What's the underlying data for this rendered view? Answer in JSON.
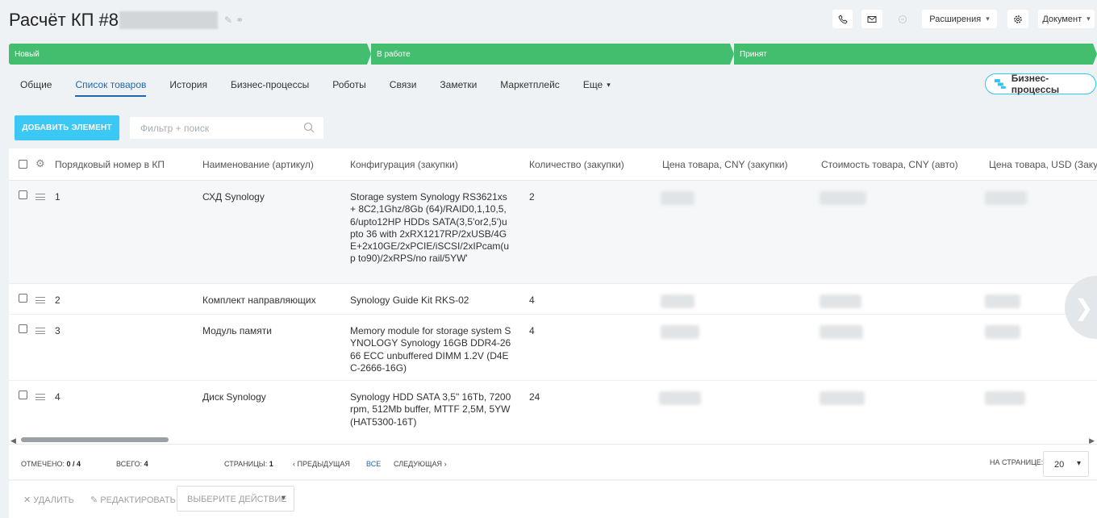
{
  "header": {
    "title": "Расчёт КП #8",
    "buttons": {
      "extensions": "Расширения",
      "document": "Документ"
    }
  },
  "stages": [
    "Новый",
    "В работе",
    "Принят"
  ],
  "tabs": [
    "Общие",
    "Список товаров",
    "История",
    "Бизнес-процессы",
    "Роботы",
    "Связи",
    "Заметки",
    "Маркетплейс",
    "Еще"
  ],
  "bp_button": "Бизнес-процессы",
  "toolbar": {
    "add_label": "ДОБАВИТЬ ЭЛЕМЕНТ",
    "filter_placeholder": "Фильтр + поиск"
  },
  "table": {
    "columns": [
      "Порядковый номер в КП",
      "Наименование (артикул)",
      "Конфигурация (закупки)",
      "Количество (закупки)",
      "Цена товара, CNY (закупки)",
      "Стоимость товара, CNY (авто)",
      "Цена товара, USD (Закупк"
    ],
    "rows": [
      {
        "num": "1",
        "name": "СХД Synology",
        "config": "Storage system Synology RS3621xs+ 8C2,1Ghz/8Gb (64)/RAID0,1,10,5,6/upto12HP HDDs SATA(3,5'or2,5')upto 36 with 2xRX1217RP/2xUSB/4GE+2x10GE/2xPCIE/iSCSI/2xIPcam(up to90)/2xRPS/no rail/5YW'",
        "qty": "2"
      },
      {
        "num": "2",
        "name": "Комплект направляющих",
        "config": "Synology Guide Kit RKS-02",
        "qty": "4"
      },
      {
        "num": "3",
        "name": "Модуль памяти",
        "config": "Memory module for storage system SYNOLOGY Synology 16GB DDR4-2666 ECC unbuffered DIMM 1.2V (D4EC-2666-16G)",
        "qty": "4"
      },
      {
        "num": "4",
        "name": "Диск Synology",
        "config": "Synology HDD SATA 3,5\" 16Tb, 7200 rpm, 512Mb buffer, MTTF 2,5M, 5YW (HAT5300-16T)",
        "qty": "24"
      }
    ]
  },
  "footer": {
    "checked_label": "ОТМЕЧЕНО:",
    "checked_value": "0 / 4",
    "total_label": "ВСЕГО:",
    "total_value": "4",
    "pages_label": "СТРАНИЦЫ:",
    "pages_value": "1",
    "prev": "ПРЕДЫДУЩАЯ",
    "all": "ВСЕ",
    "next": "СЛЕДУЮЩАЯ",
    "per_page_label": "НА СТРАНИЦЕ:",
    "per_page_value": "20"
  },
  "actions": {
    "delete": "УДАЛИТЬ",
    "edit": "РЕДАКТИРОВАТЬ",
    "select": "ВЫБЕРИТЕ ДЕЙСТВИЕ"
  },
  "icons": [
    "phone-icon",
    "mail-icon",
    "sync-icon",
    "gear-icon",
    "pencil-icon",
    "link-icon",
    "search-icon",
    "business-process-icon",
    "close-icon",
    "chevron-down-icon",
    "chevron-left-icon",
    "chevron-right-icon"
  ],
  "colors": {
    "stage": "#43bd6e",
    "accent": "#3bc8f5",
    "link": "#2067b0"
  }
}
